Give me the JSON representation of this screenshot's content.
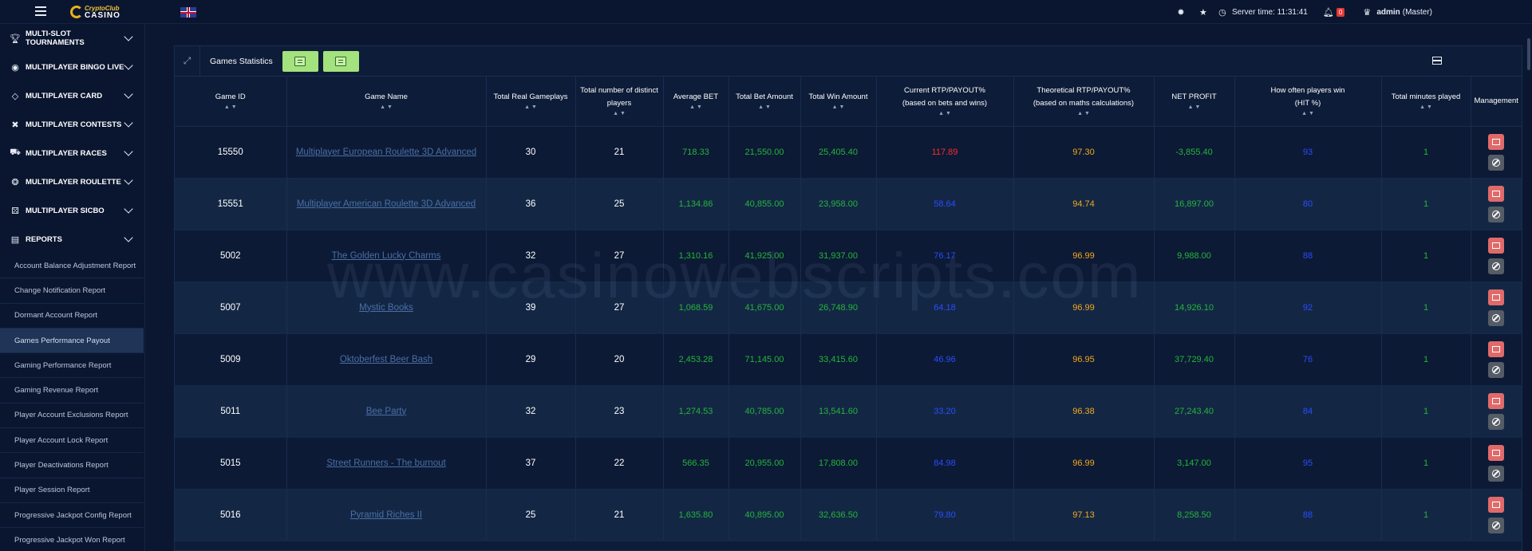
{
  "header": {
    "logo_top": "CryptoClub",
    "logo_bottom": "CASINO",
    "server_time": "Server time: 11:31:41",
    "notification_count": "0",
    "user_name": "admin",
    "user_role": "(Master)"
  },
  "sidebar": {
    "items": [
      {
        "label": "MULTI-SLOT TOURNAMENTS",
        "icon": "trophy-icon"
      },
      {
        "label": "MULTIPLAYER BINGO LIVE",
        "icon": "bingo-icon"
      },
      {
        "label": "MULTIPLAYER CARD",
        "icon": "diamond-icon"
      },
      {
        "label": "MULTIPLAYER CONTESTS",
        "icon": "swords-icon"
      },
      {
        "label": "MULTIPLAYER RACES",
        "icon": "car-icon"
      },
      {
        "label": "MULTIPLAYER ROULETTE",
        "icon": "roulette-icon"
      },
      {
        "label": "MULTIPLAYER SICBO",
        "icon": "dice-icon"
      },
      {
        "label": "REPORTS",
        "icon": "report-icon"
      }
    ],
    "reports": [
      "Account Balance Adjustment Report",
      "Change Notification Report",
      "Dormant Account Report",
      "Games Performance Payout",
      "Gaming Performance Report",
      "Gaming Revenue Report",
      "Player Account Exclusions Report",
      "Player Account Lock Report",
      "Player Deactivations Report",
      "Player Session Report",
      "Progressive Jackpot Config Report",
      "Progressive Jackpot Won Report"
    ],
    "active_report": "Games Performance Payout"
  },
  "panel": {
    "title": "Games Statistics"
  },
  "table": {
    "columns": [
      [
        "Game ID",
        ""
      ],
      [
        "Game Name",
        ""
      ],
      [
        "Total Real Gameplays",
        ""
      ],
      [
        "Total number of distinct",
        "players"
      ],
      [
        "Average BET",
        ""
      ],
      [
        "Total Bet Amount",
        ""
      ],
      [
        "Total Win Amount",
        ""
      ],
      [
        "Current RTP/PAYOUT%",
        "(based on bets and wins)"
      ],
      [
        "Theoretical RTP/PAYOUT%",
        "(based on maths calculations)"
      ],
      [
        "NET PROFIT",
        ""
      ],
      [
        "How often players win",
        "(HIT %)"
      ],
      [
        "Total minutes played",
        ""
      ],
      [
        "Management",
        ""
      ]
    ],
    "rows": [
      {
        "id": "15550",
        "name": "Multiplayer European Roulette 3D Advanced",
        "gameplays": "30",
        "players": "21",
        "avg_bet": "718.33",
        "bet_amount": "21,550.00",
        "win_amount": "25,405.40",
        "rtp": "117.89",
        "rtp_color": "red",
        "theo": "97.30",
        "profit": "-3,855.40",
        "hit": "93",
        "minutes": "1"
      },
      {
        "id": "15551",
        "name": "Multiplayer American Roulette 3D Advanced",
        "gameplays": "36",
        "players": "25",
        "avg_bet": "1,134.86",
        "bet_amount": "40,855.00",
        "win_amount": "23,958.00",
        "rtp": "58.64",
        "rtp_color": "blue",
        "theo": "94.74",
        "profit": "16,897.00",
        "hit": "80",
        "minutes": "1"
      },
      {
        "id": "5002",
        "name": "The Golden Lucky Charms",
        "gameplays": "32",
        "players": "27",
        "avg_bet": "1,310.16",
        "bet_amount": "41,925.00",
        "win_amount": "31,937.00",
        "rtp": "76.17",
        "rtp_color": "blue",
        "theo": "96.99",
        "profit": "9,988.00",
        "hit": "88",
        "minutes": "1"
      },
      {
        "id": "5007",
        "name": "Mystic Books",
        "gameplays": "39",
        "players": "27",
        "avg_bet": "1,068.59",
        "bet_amount": "41,675.00",
        "win_amount": "26,748.90",
        "rtp": "64.18",
        "rtp_color": "blue",
        "theo": "96.99",
        "profit": "14,926.10",
        "hit": "92",
        "minutes": "1"
      },
      {
        "id": "5009",
        "name": "Oktoberfest Beer Bash",
        "gameplays": "29",
        "players": "20",
        "avg_bet": "2,453.28",
        "bet_amount": "71,145.00",
        "win_amount": "33,415.60",
        "rtp": "46.96",
        "rtp_color": "blue",
        "theo": "96.95",
        "profit": "37,729.40",
        "hit": "76",
        "minutes": "1"
      },
      {
        "id": "5011",
        "name": "Bee Party",
        "gameplays": "32",
        "players": "23",
        "avg_bet": "1,274.53",
        "bet_amount": "40,785.00",
        "win_amount": "13,541.60",
        "rtp": "33.20",
        "rtp_color": "blue",
        "theo": "96.38",
        "profit": "27,243.40",
        "hit": "84",
        "minutes": "1"
      },
      {
        "id": "5015",
        "name": "Street Runners - The burnout",
        "gameplays": "37",
        "players": "22",
        "avg_bet": "566.35",
        "bet_amount": "20,955.00",
        "win_amount": "17,808.00",
        "rtp": "84.98",
        "rtp_color": "blue",
        "theo": "96.99",
        "profit": "3,147.00",
        "hit": "95",
        "minutes": "1"
      },
      {
        "id": "5016",
        "name": "Pyramid Riches II",
        "gameplays": "25",
        "players": "21",
        "avg_bet": "1,635.80",
        "bet_amount": "40,895.00",
        "win_amount": "32,636.50",
        "rtp": "79.80",
        "rtp_color": "blue",
        "theo": "97.13",
        "profit": "8,258.50",
        "hit": "88",
        "minutes": "1"
      }
    ]
  },
  "watermark": "www.casinowebscripts.com",
  "colors": {
    "green": "#25b43a",
    "red": "#ff2a2a",
    "blue": "#2a4cff",
    "orange": "#f4a71c"
  }
}
